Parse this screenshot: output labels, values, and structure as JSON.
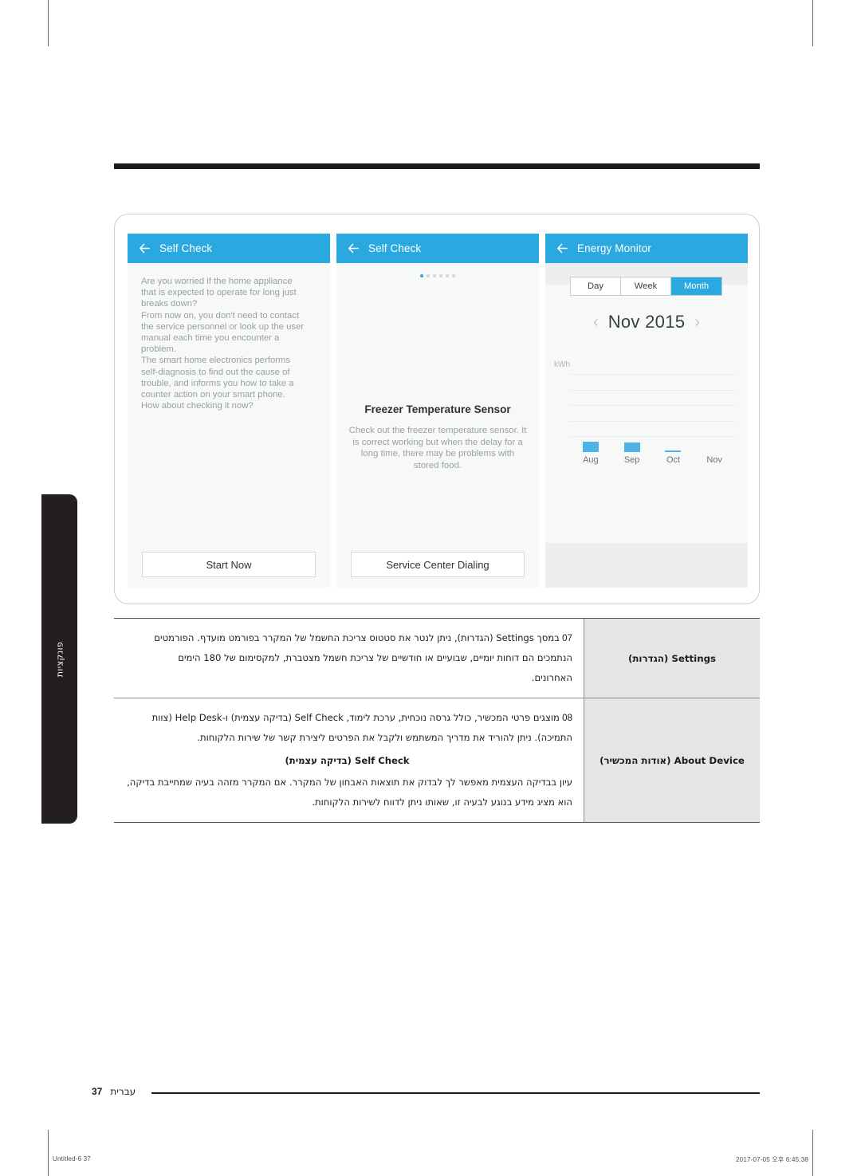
{
  "side_tab": {
    "label": "פונקציות"
  },
  "screens": [
    {
      "name": "self-check-intro",
      "title": "Self Check",
      "back_icon": "back-arrow-icon",
      "body_text": "Are you worried if the home appliance\nthat is expected to operate for long just\nbreaks down?\nFrom now on, you don't need to contact\nthe service personnel or look up the user\nmanual each time you encounter a\nproblem.\nThe smart home electronics performs\nself-diagnosis to find out the cause of\ntrouble, and informs you how to take a\ncounter action on your smart phone.\nHow about checking it now?",
      "button": "Start Now"
    },
    {
      "name": "self-check-result",
      "title": "Self Check",
      "back_icon": "back-arrow-icon",
      "sensor_title": "Freezer Temperature Sensor",
      "sensor_desc": "Check out the freezer temperature sensor. It is correct working but when the delay for a long time, there may be problems with stored food.",
      "dots_total": 6,
      "dots_active": 1,
      "button": "Service Center Dialing"
    },
    {
      "name": "energy-monitor",
      "title": "Energy Monitor",
      "back_icon": "back-arrow-icon",
      "segments": [
        "Day",
        "Week",
        "Month"
      ],
      "segment_selected": "Month",
      "month_label": "Nov 2015",
      "prev_icon": "chevron-left-icon",
      "next_icon": "chevron-right-icon"
    }
  ],
  "chart_data": {
    "type": "bar",
    "title": "",
    "categories": [
      "Aug",
      "Sep",
      "Oct",
      "Nov"
    ],
    "values": [
      13,
      12,
      2,
      0
    ],
    "xlabel": "",
    "ylabel": "kWh",
    "ylim": [
      0,
      100
    ],
    "gridlines": 5,
    "grid": true,
    "legend": "none",
    "bar_color": "#4fb3e8"
  },
  "table": {
    "rows": [
      {
        "number": "07",
        "label": "Settings (הגדרות)",
        "lines": [
          "במסך Settings (הגדרות), ניתן לנטר את סטטוס צריכת החשמל של המקרר בפורמט מועדף. הפורמטים",
          "הנתמכים הם דוחות יומיים, שבועיים או חודשיים של צריכת חשמל מצטברת, למקסימום של 180 הימים",
          "האחרונים."
        ]
      },
      {
        "number": "08",
        "label": "About Device (אודות המכשיר)",
        "lines": [
          "מוצגים פרטי המכשיר, כולל גרסה נוכחית, ערכת לימוד, Self Check (בדיקה עצמית) ו-Help Desk (צוות",
          "התמיכה). ניתן להוריד את מדריך המשתמש ולקבל את הפרטים ליצירת קשר של שירות הלקוחות."
        ],
        "sub_heading": "Self Check (בדיקה עצמית)",
        "sub_lines": [
          "עיון בבדיקה העצמית מאפשר לך לבדוק את תוצאות האבחון של המקרר. אם המקרר מזהה בעיה שמחייבת בדיקה,",
          "הוא מציג מידע בנוגע לבעיה זו, שאותו ניתן לדווח לשירות הלקוחות."
        ]
      }
    ]
  },
  "page_footer": {
    "number": "37",
    "language": "עברית"
  },
  "print_footer": {
    "left": "Untitled-6   37",
    "right": "2017-07-05   오후 6:45:38"
  }
}
